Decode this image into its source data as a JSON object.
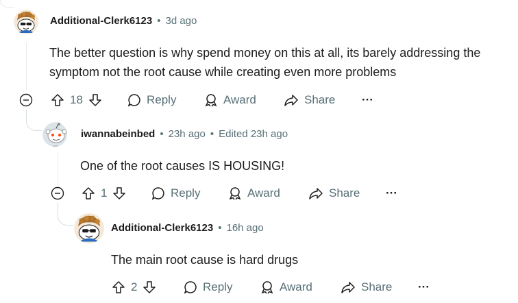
{
  "comments": [
    {
      "username": "Additional-Clerk6123",
      "separator": "•",
      "time": "3d ago",
      "body_line1": "The better question is why spend money on this at all, its barely addressing the",
      "body_line2": "symptom not the root cause while creating even more problems",
      "votes": "18",
      "reply_label": "Reply",
      "award_label": "Award",
      "share_label": "Share",
      "more_label": "···"
    },
    {
      "username": "iwannabeinbed",
      "separator": "•",
      "time": "23h ago",
      "separator2": "•",
      "edited": "Edited 23h ago",
      "body_line1": "One of the root causes IS HOUSING!",
      "votes": "1",
      "reply_label": "Reply",
      "award_label": "Award",
      "share_label": "Share",
      "more_label": "···"
    },
    {
      "username": "Additional-Clerk6123",
      "separator": "•",
      "time": "16h ago",
      "body_line1": "The main root cause is hard drugs",
      "votes": "2",
      "reply_label": "Reply",
      "award_label": "Award",
      "share_label": "Share",
      "more_label": "···"
    }
  ],
  "colors": {
    "text": "#1c1c1c",
    "meta": "#576f76",
    "thread_line": "#d4dde0"
  }
}
